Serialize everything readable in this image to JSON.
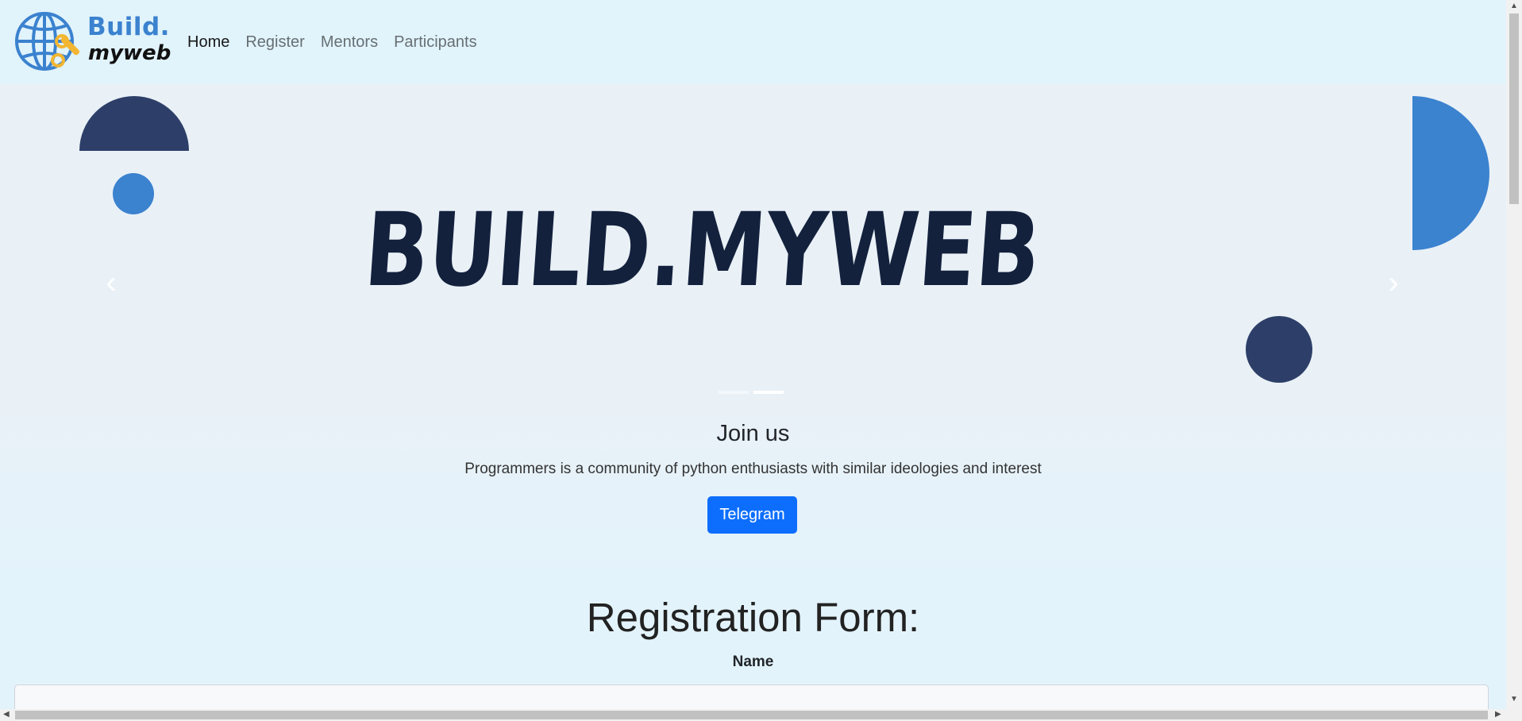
{
  "brand": {
    "line1": "Build.",
    "line2": "myweb",
    "logo_icon": "globe-wrench-icon"
  },
  "nav": {
    "items": [
      {
        "label": "Home",
        "active": true
      },
      {
        "label": "Register",
        "active": false
      },
      {
        "label": "Mentors",
        "active": false
      },
      {
        "label": "Participants",
        "active": false
      }
    ]
  },
  "hero": {
    "title_graphic": "BUILD.MYWEB",
    "prev_icon": "chevron-left-icon",
    "next_icon": "chevron-right-icon",
    "slides": 2,
    "active_slide": 2
  },
  "join": {
    "title": "Join us",
    "text": "Programmers is a community of python enthusiasts with similar ideologies and interest",
    "button": "Telegram"
  },
  "form": {
    "title": "Registration Form:",
    "name_label": "Name",
    "name_value": ""
  },
  "colors": {
    "accent": "#0d6efd",
    "brand_blue": "#3b82cf",
    "navy": "#14213d",
    "dark_circle": "#2d3f68"
  }
}
